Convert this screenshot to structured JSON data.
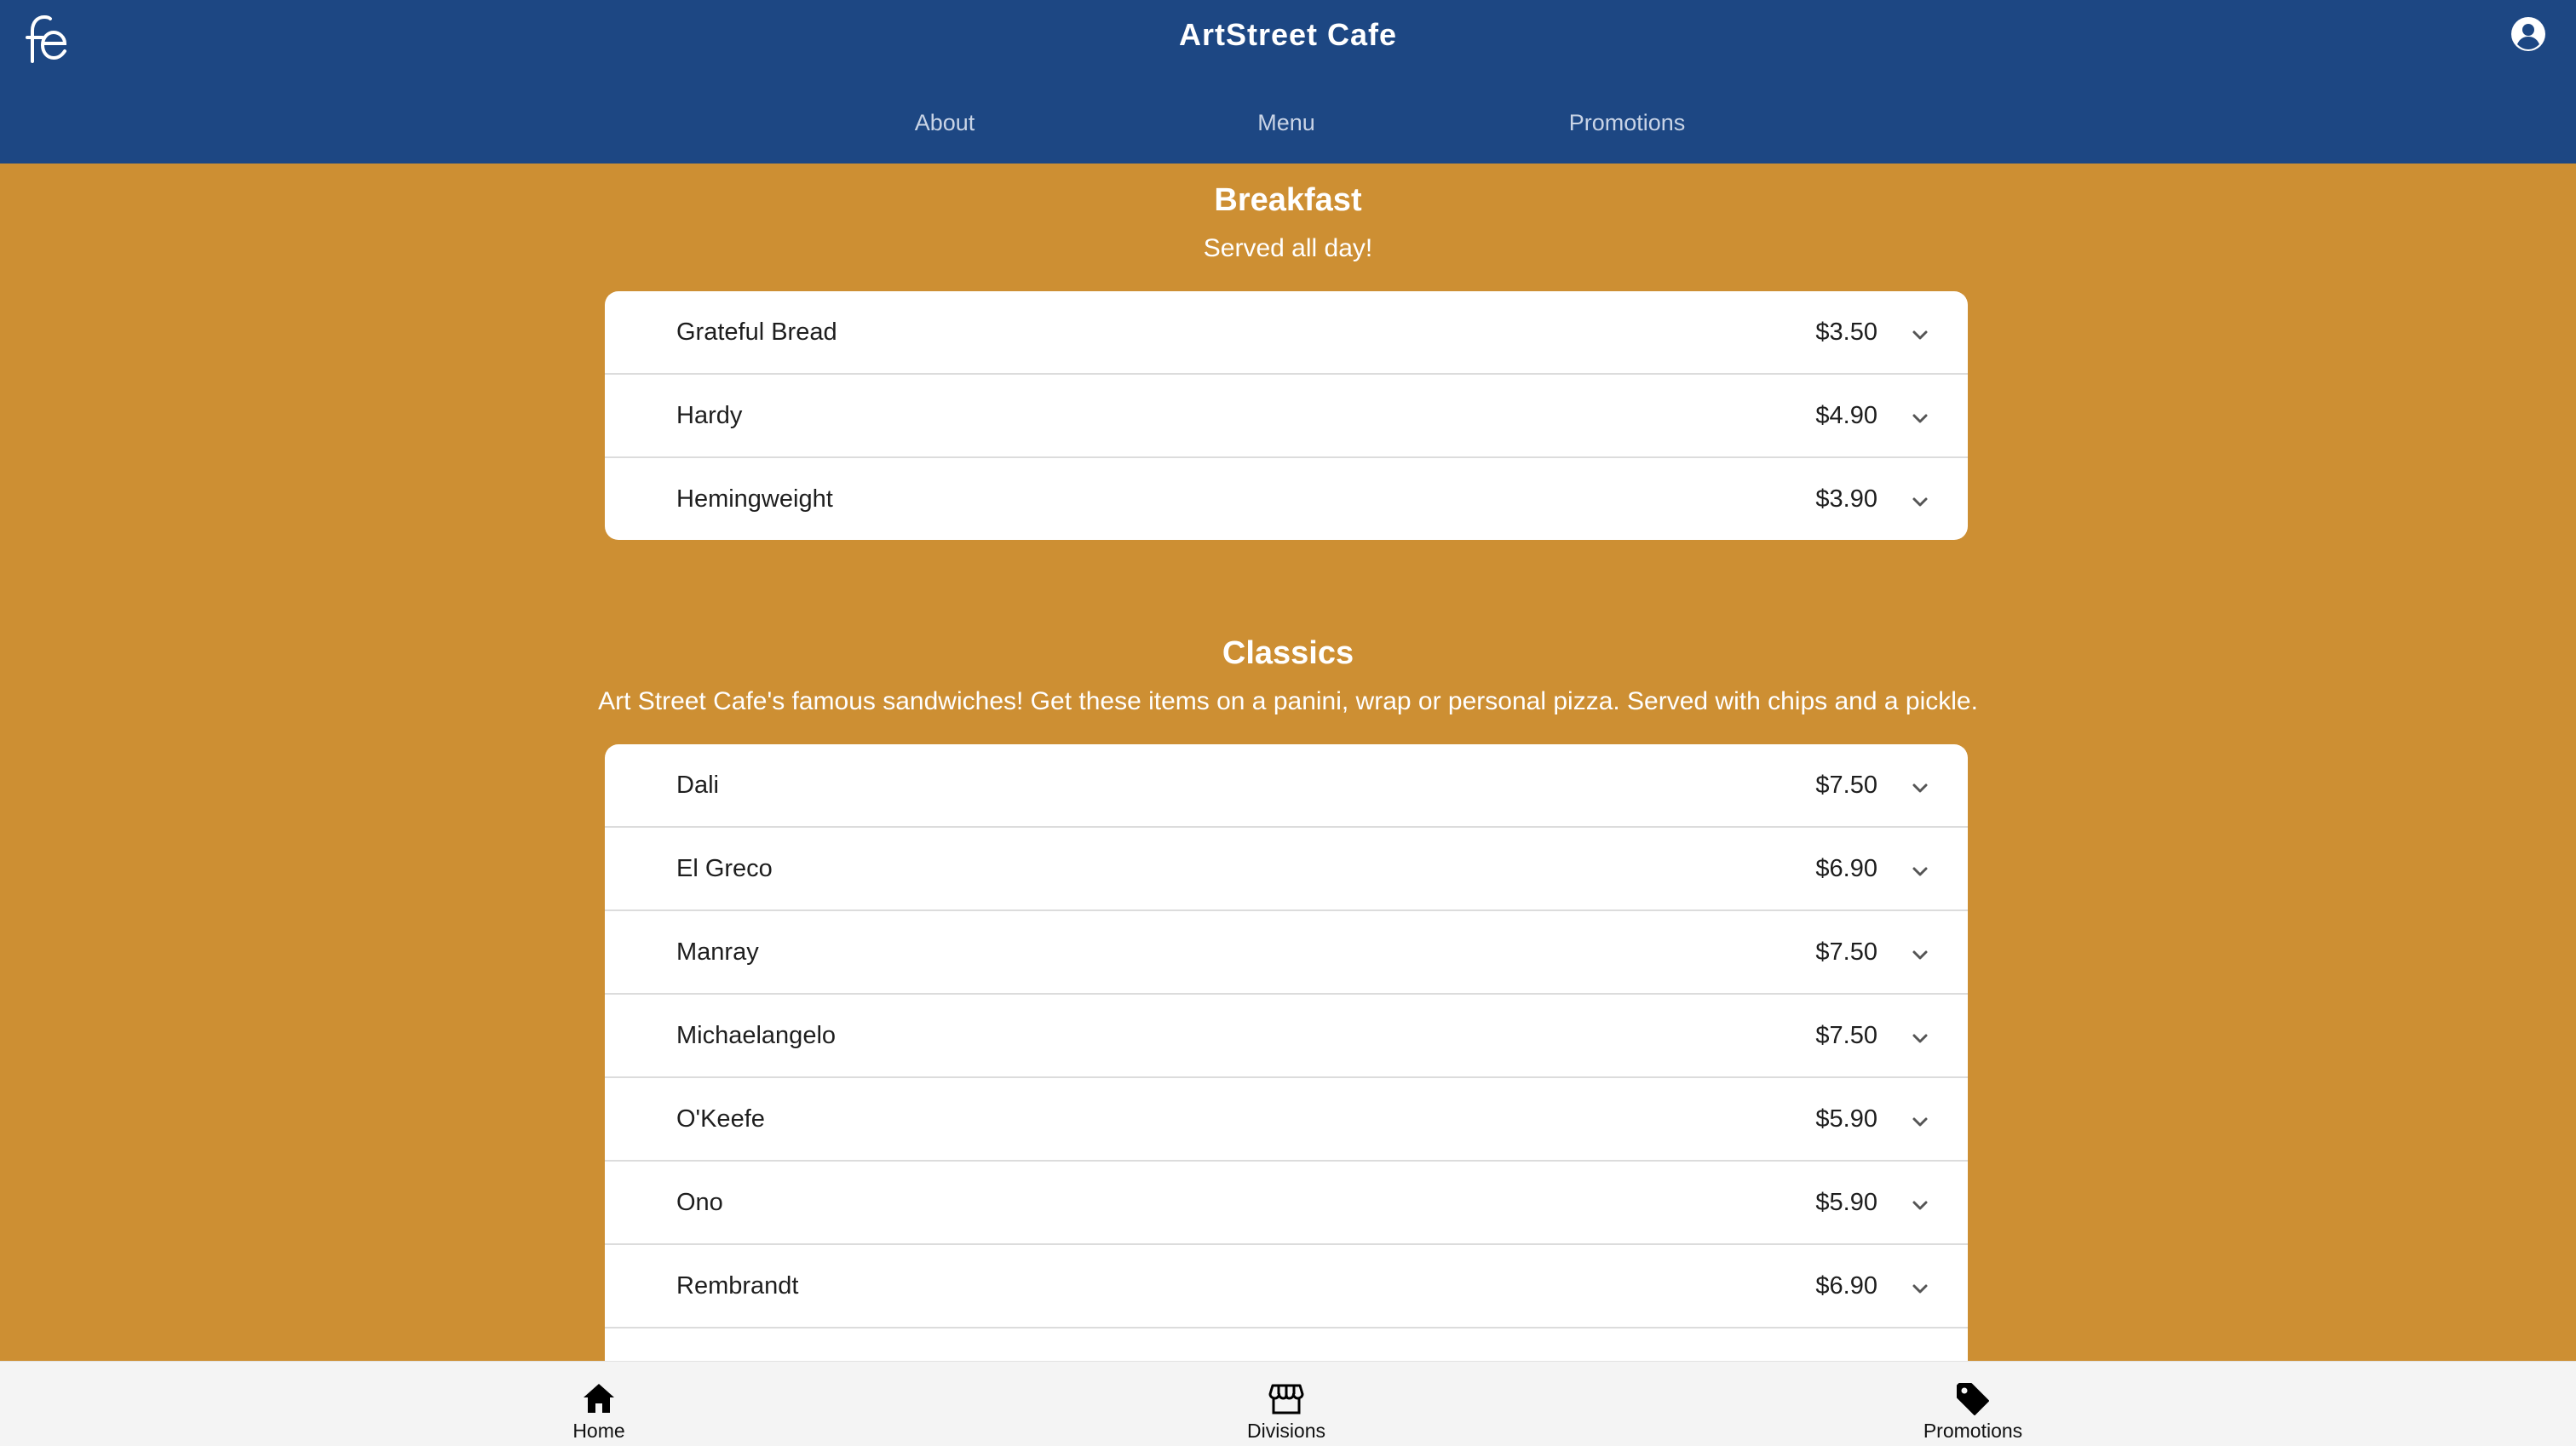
{
  "header": {
    "logo_text": "fe",
    "title": "ArtStreet Cafe",
    "account_icon": "account-circle-icon",
    "nav": [
      {
        "label": "About"
      },
      {
        "label": "Menu"
      },
      {
        "label": "Promotions"
      }
    ]
  },
  "sections": [
    {
      "title": "Breakfast",
      "subtitle": "Served all day!",
      "items": [
        {
          "name": "Grateful Bread",
          "price": "$3.50"
        },
        {
          "name": "Hardy",
          "price": "$4.90"
        },
        {
          "name": "Hemingweight",
          "price": "$3.90"
        }
      ]
    },
    {
      "title": "Classics",
      "subtitle": "Art Street Cafe's famous sandwiches! Get these items on a panini, wrap or personal pizza. Served with chips and a pickle.",
      "items": [
        {
          "name": "Dali",
          "price": "$7.50"
        },
        {
          "name": "El Greco",
          "price": "$6.90"
        },
        {
          "name": "Manray",
          "price": "$7.50"
        },
        {
          "name": "Michaelangelo",
          "price": "$7.50"
        },
        {
          "name": "O'Keefe",
          "price": "$5.90"
        },
        {
          "name": "Ono",
          "price": "$5.90"
        },
        {
          "name": "Rembrandt",
          "price": "$6.90"
        },
        {
          "name": "",
          "price": ""
        }
      ]
    }
  ],
  "bottom_nav": [
    {
      "label": "Home",
      "icon": "home-icon"
    },
    {
      "label": "Divisions",
      "icon": "storefront-icon"
    },
    {
      "label": "Promotions",
      "icon": "tag-icon"
    }
  ],
  "colors": {
    "header_bg": "#1d4783",
    "page_bg": "#cd8f33",
    "card_bg": "#ffffff",
    "bottom_bar_bg": "#f4f4f4"
  }
}
